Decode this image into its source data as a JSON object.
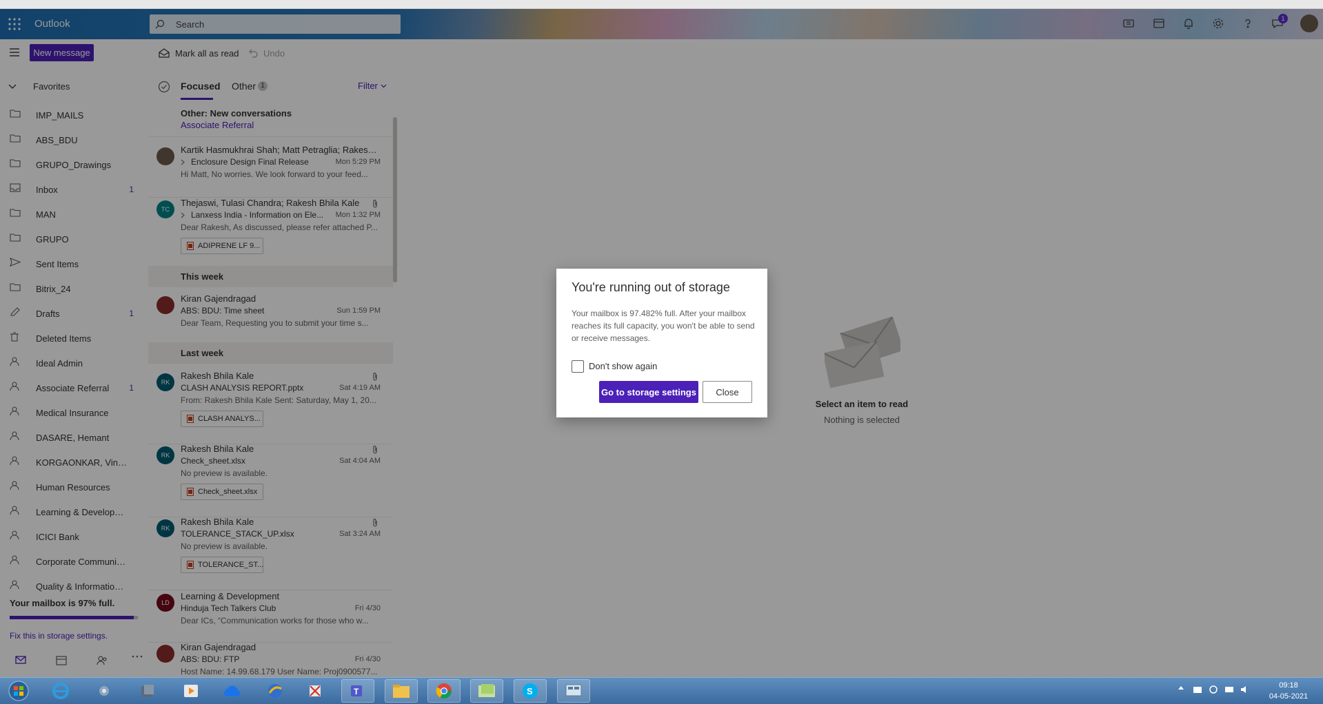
{
  "header": {
    "app_name": "Outlook",
    "search_placeholder": "Search",
    "notification_count": "1"
  },
  "commands": {
    "new_message": "New message",
    "mark_all_read": "Mark all as read",
    "undo": "Undo"
  },
  "nav": {
    "favorites_label": "Favorites",
    "items": [
      {
        "label": "IMP_MAILS",
        "count": "",
        "icon": "folder-icon"
      },
      {
        "label": "ABS_BDU",
        "count": "",
        "icon": "folder-icon"
      },
      {
        "label": "GRUPO_Drawings",
        "count": "",
        "icon": "folder-icon"
      },
      {
        "label": "Inbox",
        "count": "1",
        "icon": "inbox-icon"
      },
      {
        "label": "MAN",
        "count": "",
        "icon": "folder-icon"
      },
      {
        "label": "GRUPO",
        "count": "",
        "icon": "folder-icon"
      },
      {
        "label": "Sent Items",
        "count": "",
        "icon": "send-icon"
      },
      {
        "label": "Bitrix_24",
        "count": "",
        "icon": "folder-icon"
      },
      {
        "label": "Drafts",
        "count": "1",
        "icon": "pencil-icon"
      },
      {
        "label": "Deleted Items",
        "count": "",
        "icon": "trash-icon"
      },
      {
        "label": "Ideal Admin",
        "count": "",
        "icon": "person-icon"
      },
      {
        "label": "Associate Referral",
        "count": "1",
        "icon": "person-icon"
      },
      {
        "label": "Medical Insurance",
        "count": "",
        "icon": "person-icon"
      },
      {
        "label": "DASARE, Hemant",
        "count": "",
        "icon": "person-icon"
      },
      {
        "label": "KORGAONKAR, Vinay...",
        "count": "",
        "icon": "person-icon"
      },
      {
        "label": "Human Resources",
        "count": "",
        "icon": "person-icon"
      },
      {
        "label": "Learning & Developm...",
        "count": "",
        "icon": "person-icon"
      },
      {
        "label": "ICICI Bank",
        "count": "",
        "icon": "person-icon"
      },
      {
        "label": "Corporate Communic...",
        "count": "",
        "icon": "person-icon"
      },
      {
        "label": "Quality & Information...",
        "count": "",
        "icon": "person-icon"
      }
    ],
    "storage_text": "Your mailbox is 97% full.",
    "storage_fraction": 0.97,
    "storage_link": "Fix this in storage settings."
  },
  "list": {
    "tab_focused": "Focused",
    "tab_other": "Other",
    "other_count": "1",
    "filter": "Filter",
    "other_banner_title": "Other: New conversations",
    "other_banner_sub": "Associate Referral",
    "sections": {
      "this_week": "This week",
      "last_week": "Last week"
    },
    "emails": [
      {
        "from": "Kartik Hasmukhrai Shah; Matt Petraglia; Rakesh B...",
        "subject": "Enclosure Design Final Release",
        "date": "Mon 5:29 PM",
        "preview": "Hi Matt, No worries. We look forward to your feed...",
        "initials": "",
        "avatar_color": "#6b5b4b",
        "attachment": "",
        "thread": true
      },
      {
        "from": "Thejaswi, Tulasi Chandra; Rakesh Bhila Kale",
        "subject": "Lanxess India - Information on Ele...",
        "date": "Mon 1:32 PM",
        "preview": "Dear Rakesh, As discussed, please refer attached P...",
        "initials": "TC",
        "avatar_color": "#038387",
        "attachment": "ADIPRENE LF 9...",
        "thread": true
      },
      {
        "from": "Kiran Gajendragad",
        "subject": "ABS: BDU: Time sheet",
        "date": "Sun 1:59 PM",
        "preview": "Dear Team, Requesting you to submit your time s...",
        "initials": "",
        "avatar_color": "#8a2c2c",
        "attachment": "",
        "thread": false
      },
      {
        "from": "Rakesh Bhila Kale",
        "subject": "CLASH ANALYSIS REPORT.pptx",
        "date": "Sat 4:19 AM",
        "preview": "From: Rakesh Bhila Kale Sent: Saturday, May 1, 20...",
        "initials": "RK",
        "avatar_color": "#005b70",
        "attachment": "CLASH ANALYS...",
        "thread": false
      },
      {
        "from": "Rakesh Bhila Kale",
        "subject": "Check_sheet.xlsx",
        "date": "Sat 4:04 AM",
        "preview": "No preview is available.",
        "initials": "RK",
        "avatar_color": "#005b70",
        "attachment": "Check_sheet.xlsx",
        "thread": false
      },
      {
        "from": "Rakesh Bhila Kale",
        "subject": "TOLERANCE_STACK_UP.xlsx",
        "date": "Sat 3:24 AM",
        "preview": "No preview is available.",
        "initials": "RK",
        "avatar_color": "#005b70",
        "attachment": "TOLERANCE_ST...",
        "thread": false
      },
      {
        "from": "Learning & Development",
        "subject": "Hinduja Tech Talkers Club",
        "date": "Fri 4/30",
        "preview": "Dear ICs, “Communication works for those who w...",
        "initials": "LD",
        "avatar_color": "#750b1c",
        "attachment": "",
        "thread": false
      },
      {
        "from": "Kiran Gajendragad",
        "subject": "ABS: BDU: FTP",
        "date": "Fri 4/30",
        "preview": "Host Name: 14.99.68.179 User Name: Proj0900577...",
        "initials": "",
        "avatar_color": "#8a2c2c",
        "attachment": "",
        "thread": false
      }
    ]
  },
  "reading_pane": {
    "title": "Select an item to read",
    "subtitle": "Nothing is selected"
  },
  "dialog": {
    "title": "You're running out of storage",
    "body": "Your mailbox is 97.482% full. After your mailbox reaches its full capacity, you won't be able to send or receive messages.",
    "checkbox_label": "Don't show again",
    "primary_button": "Go to storage settings",
    "close_button": "Close"
  },
  "taskbar": {
    "time": "09:18",
    "date": "04-05-2021"
  },
  "colors": {
    "accent": "#4b21b8",
    "overlay": "rgba(0,0,0,0.4)"
  }
}
